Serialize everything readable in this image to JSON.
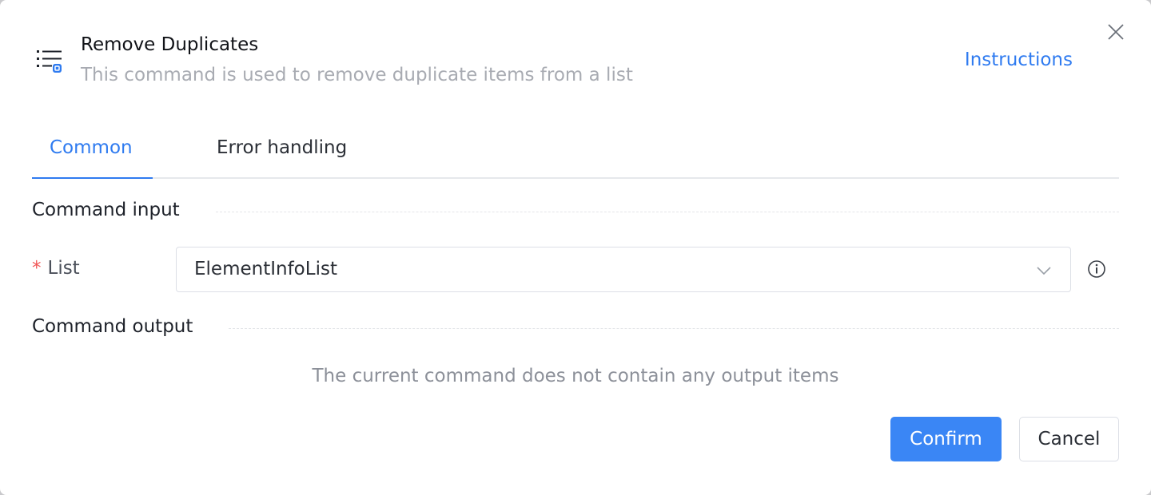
{
  "header": {
    "title": "Remove Duplicates",
    "subtitle": "This command is used to remove duplicate items from a list",
    "instructions_link": "Instructions",
    "command_icon": "list-remove-duplicates-icon",
    "close_icon": "close-icon"
  },
  "tabs": [
    {
      "label": "Common",
      "active": true
    },
    {
      "label": "Error handling",
      "active": false
    }
  ],
  "command_input": {
    "section_title": "Command input",
    "fields": [
      {
        "label": "List",
        "required_mark": "*",
        "value": "ElementInfoList",
        "dropdown_icon": "chevron-down-icon",
        "help_icon": "info-icon"
      }
    ]
  },
  "command_output": {
    "section_title": "Command output",
    "empty_message": "The current command does not contain any output items"
  },
  "footer": {
    "confirm_label": "Confirm",
    "cancel_label": "Cancel"
  },
  "colors": {
    "accent": "#2f7bf0",
    "confirm_bg": "#3a86f5",
    "required": "#f05555",
    "muted_text": "#a8abb2"
  }
}
